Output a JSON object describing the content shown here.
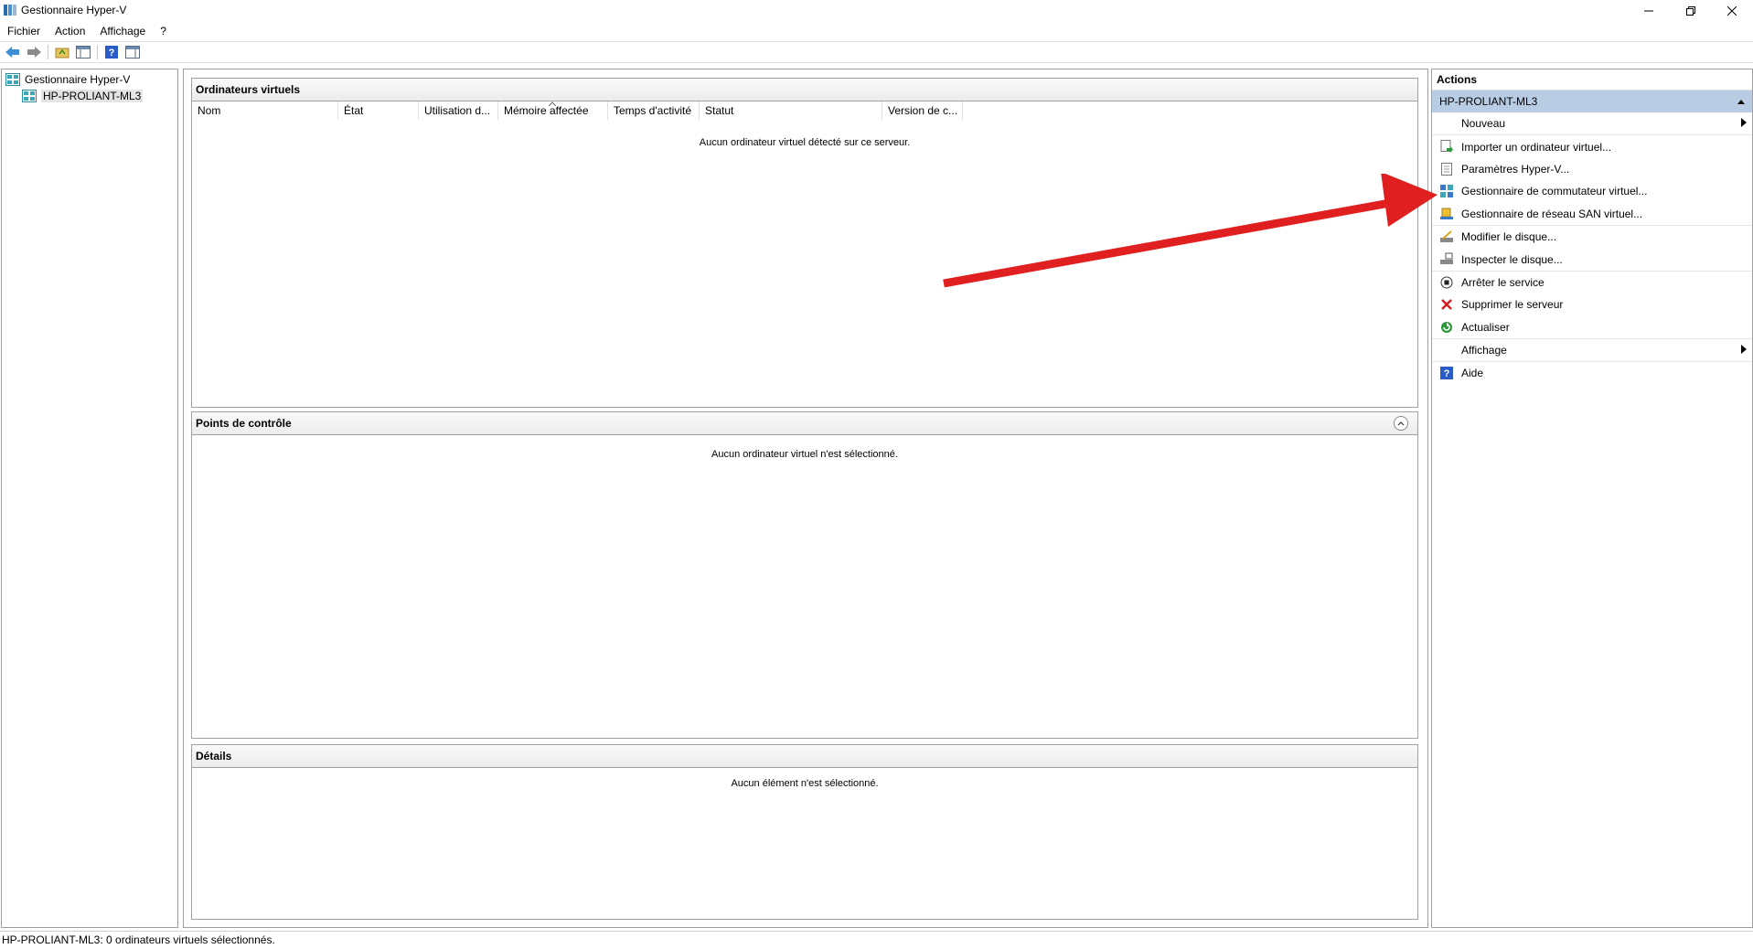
{
  "window": {
    "title": "Gestionnaire Hyper-V"
  },
  "menu": [
    "Fichier",
    "Action",
    "Affichage",
    "?"
  ],
  "toolbar": {
    "icons": [
      "back-arrow-icon",
      "forward-arrow-icon",
      "folder-up-icon",
      "show-hide-tree-icon",
      "help-icon",
      "show-hide-action-pane-icon"
    ]
  },
  "tree": {
    "root": "Gestionnaire Hyper-V",
    "server": "HP-PROLIANT-ML3"
  },
  "vm_pane": {
    "title": "Ordinateurs virtuels",
    "columns": [
      "Nom",
      "État",
      "Utilisation d...",
      "Mémoire affectée",
      "Temps d'activité",
      "Statut",
      "Version de c..."
    ],
    "empty_message": "Aucun ordinateur virtuel détecté sur ce serveur."
  },
  "checkpoints_pane": {
    "title": "Points de contrôle",
    "empty_message": "Aucun ordinateur virtuel n'est sélectionné."
  },
  "details_pane": {
    "title": "Détails",
    "empty_message": "Aucun élément n'est sélectionné."
  },
  "actions": {
    "title": "Actions",
    "group": "HP-PROLIANT-ML3",
    "items": [
      {
        "label": "Nouveau",
        "icon": "none",
        "submenu": true
      },
      {
        "label": "Importer un ordinateur virtuel...",
        "icon": "import-icon"
      },
      {
        "label": "Paramètres Hyper-V...",
        "icon": "settings-page-icon"
      },
      {
        "label": "Gestionnaire de commutateur virtuel...",
        "icon": "virtual-switch-icon"
      },
      {
        "label": "Gestionnaire de réseau SAN virtuel...",
        "icon": "san-icon"
      },
      {
        "label": "Modifier le disque...",
        "icon": "edit-disk-icon"
      },
      {
        "label": "Inspecter le disque...",
        "icon": "inspect-disk-icon"
      },
      {
        "label": "Arrêter le service",
        "icon": "stop-icon"
      },
      {
        "label": "Supprimer le serveur",
        "icon": "delete-x-icon"
      },
      {
        "label": "Actualiser",
        "icon": "refresh-icon"
      },
      {
        "label": "Affichage",
        "icon": "none",
        "submenu": true
      },
      {
        "label": "Aide",
        "icon": "help-icon"
      }
    ]
  },
  "status_bar": {
    "text": "HP-PROLIANT-ML3:  0 ordinateurs virtuels sélectionnés."
  },
  "colors": {
    "actions_group_bg": "#b8cde4",
    "arrow": "#e02020"
  }
}
